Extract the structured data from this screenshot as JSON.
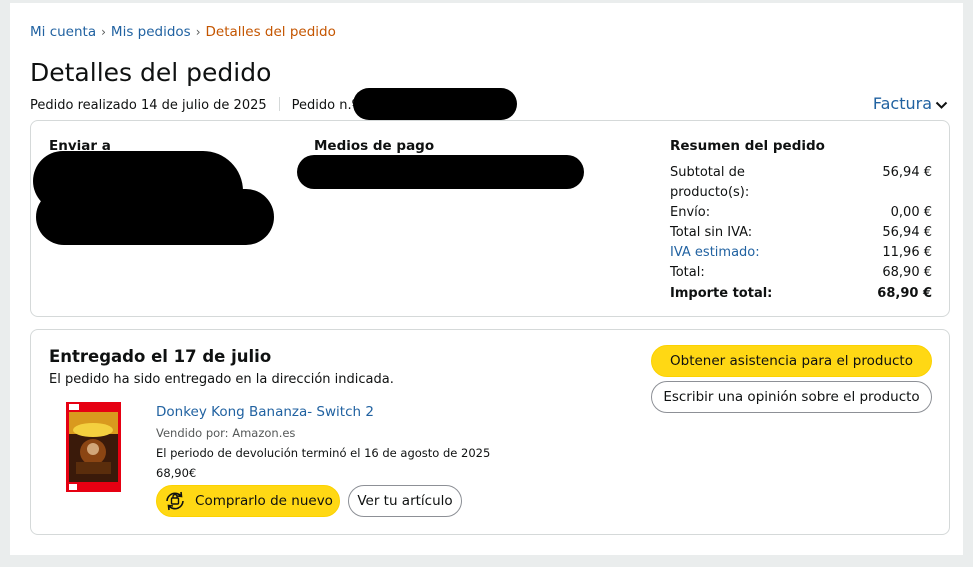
{
  "breadcrumb": {
    "items": [
      "Mi cuenta",
      "Mis pedidos"
    ],
    "current": "Detalles del pedido",
    "separator": "›"
  },
  "page_title": "Detalles del pedido",
  "order_meta": {
    "placed": "Pedido realizado 14 de julio de 2025",
    "order_number_label": "Pedido n.º"
  },
  "invoice_label": "Factura",
  "shipping": {
    "title": "Enviar a"
  },
  "payment": {
    "title": "Medios de pago"
  },
  "summary": {
    "title": "Resumen del pedido",
    "rows": [
      {
        "label": "Subtotal de producto(s):",
        "value": "56,94 €"
      },
      {
        "label": "Envío:",
        "value": "0,00 €"
      },
      {
        "label": "Total sin IVA:",
        "value": "56,94 €"
      },
      {
        "label": "IVA estimado:",
        "value": "11,96 €"
      },
      {
        "label": "Total:",
        "value": "68,90 €"
      }
    ],
    "grand_total": {
      "label": "Importe total:",
      "value": "68,90 €"
    }
  },
  "delivery": {
    "title": "Entregado el 17 de julio",
    "subtitle": "El pedido ha sido entregado en la dirección indicada."
  },
  "product": {
    "name": "Donkey Kong Bananza- Switch 2",
    "sold_by": "Vendido por: Amazon.es",
    "return_note": "El periodo de devolución terminó el 16 de agosto de 2025",
    "price": "68,90€",
    "buy_again_label": "Comprarlo de nuevo",
    "view_label": "Ver tu artículo"
  },
  "actions": {
    "support_label": "Obtener asistencia para el producto",
    "review_label": "Escribir una opinión sobre el producto"
  },
  "colors": {
    "link": "#2162a1",
    "breadcrumb_current": "#c45500",
    "button_yellow": "#ffd814",
    "border": "#d5d9d9"
  }
}
